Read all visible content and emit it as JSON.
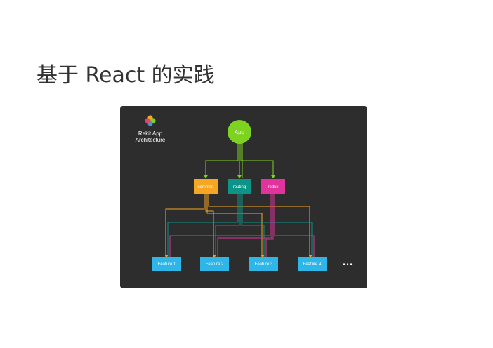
{
  "slide": {
    "title": "基于 React 的实践"
  },
  "diagram": {
    "logo": {
      "line1": "Rekit App",
      "line2": "Architecture",
      "petal_colors": [
        "#f5a623",
        "#7ed321",
        "#4a90e2",
        "#e0446b"
      ]
    },
    "root": {
      "label": "App",
      "color": "#7ed321"
    },
    "modules": [
      {
        "label": "common",
        "color": "#f5a623"
      },
      {
        "label": "routing",
        "color": "#0d9488"
      },
      {
        "label": "redux",
        "color": "#e0339b"
      }
    ],
    "features": [
      {
        "label": "Feature 1",
        "color": "#2fb6e8"
      },
      {
        "label": "Feature 2",
        "color": "#2fb6e8"
      },
      {
        "label": "Feature 3",
        "color": "#2fb6e8"
      },
      {
        "label": "Feature 4",
        "color": "#2fb6e8"
      }
    ],
    "more": "• • •",
    "background": "#2d2d2d"
  }
}
